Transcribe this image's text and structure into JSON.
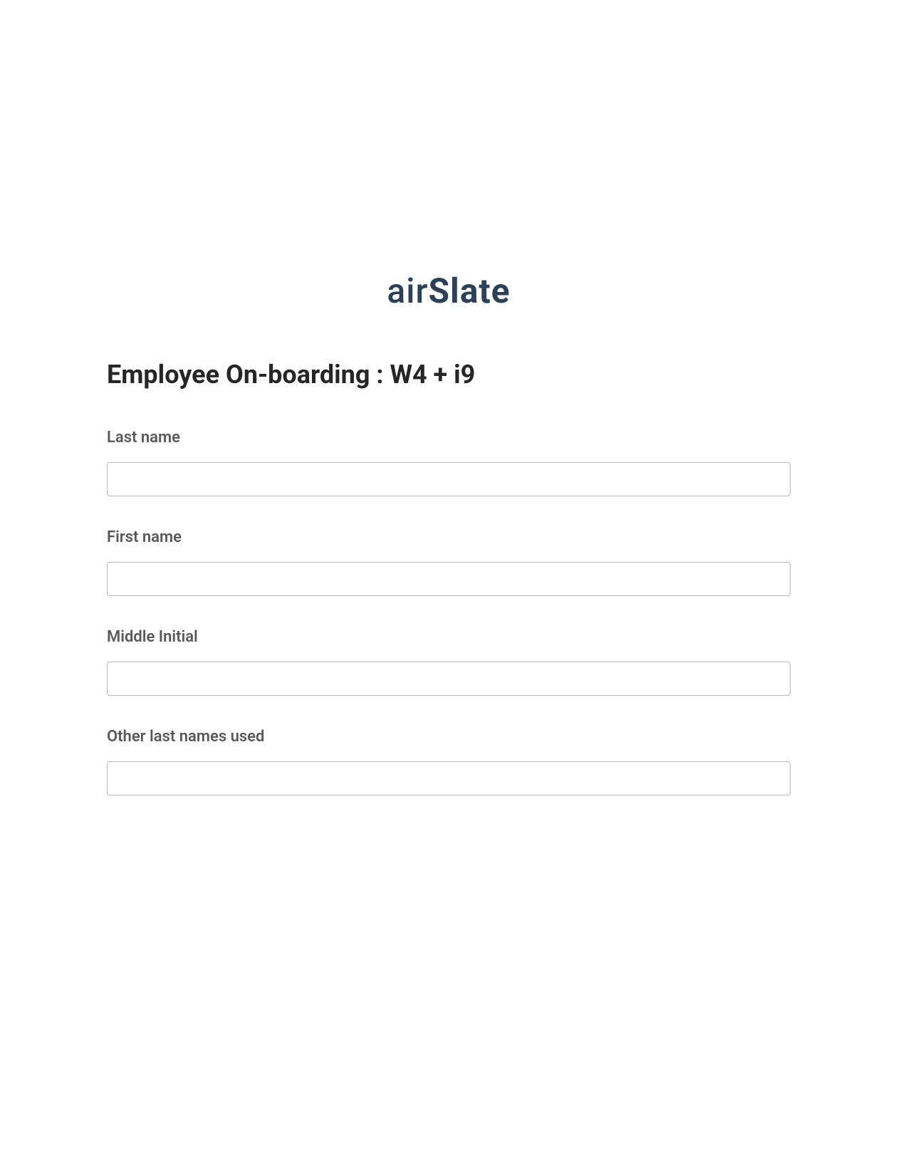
{
  "brand": {
    "name_part1": "air",
    "name_part2": "Slate",
    "color": "#2c4059"
  },
  "form": {
    "title": "Employee On-boarding : W4 + i9",
    "fields": [
      {
        "label": "Last name",
        "value": ""
      },
      {
        "label": "First name",
        "value": ""
      },
      {
        "label": "Middle Initial",
        "value": ""
      },
      {
        "label": "Other last names used",
        "value": ""
      }
    ]
  }
}
